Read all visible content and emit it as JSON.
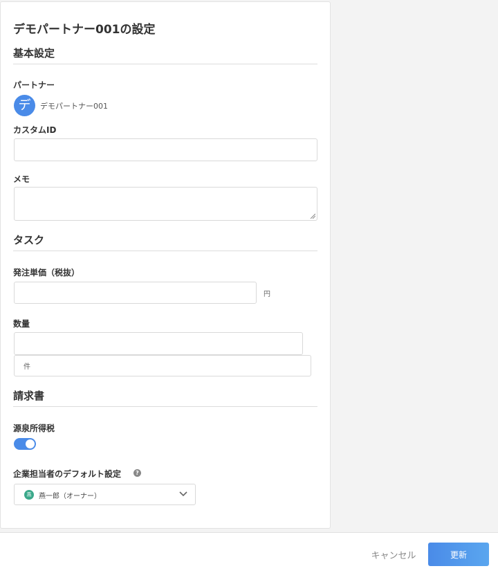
{
  "dialog": {
    "title": "デモパートナー001の設定"
  },
  "basic": {
    "heading": "基本設定",
    "partner_label": "パートナー",
    "partner_avatar_char": "デ",
    "partner_name": "デモパートナー001",
    "custom_id_label": "カスタムID",
    "custom_id_value": "",
    "memo_label": "メモ",
    "memo_value": ""
  },
  "task": {
    "heading": "タスク",
    "unit_price_label": "発注単価（税抜）",
    "unit_price_value": "",
    "unit_price_suffix": "円",
    "quantity_label": "数量",
    "quantity_value": "",
    "quantity_suffix": "件"
  },
  "invoice": {
    "heading": "請求書",
    "withholding_label": "源泉所得税",
    "withholding_enabled": true,
    "default_assignee_label": "企業担当者のデフォルト設定",
    "help_icon_char": "?",
    "assignee_avatar_char": "燕",
    "assignee_selected": "燕一郎（オーナー）",
    "assignee_avatar_color": "#3aa88a"
  },
  "footer": {
    "cancel_label": "キャンセル",
    "update_label": "更新"
  },
  "colors": {
    "accent": "#4a8be8",
    "background": "#f3f3f3"
  },
  "icons": [
    "help-icon",
    "chevron-down-icon",
    "resize-grip-icon"
  ]
}
